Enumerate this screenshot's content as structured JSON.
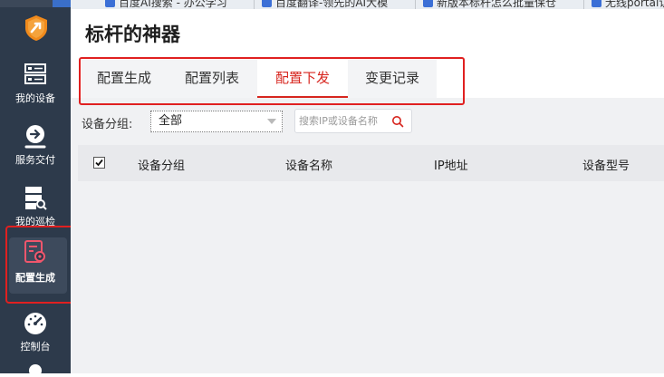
{
  "bookmarks": [
    {
      "label": "百度AI搜索 - 办公学习"
    },
    {
      "label": "百度翻译-领先的AI大模"
    },
    {
      "label": "新版本标杆怎么批量保仓"
    },
    {
      "label": "无线portal认"
    }
  ],
  "sidebar": {
    "items": [
      {
        "label": "我的设备",
        "icon": "server-icon"
      },
      {
        "label": "服务交付",
        "icon": "delivery-icon"
      },
      {
        "label": "我的巡检",
        "icon": "inspection-icon"
      },
      {
        "label": "配置生成",
        "icon": "config-gear-icon",
        "active": true
      },
      {
        "label": "控制台",
        "icon": "dashboard-gauge-icon"
      }
    ]
  },
  "header": {
    "title": "标杆的神器"
  },
  "tabs": [
    {
      "label": "配置生成"
    },
    {
      "label": "配置列表"
    },
    {
      "label": "配置下发",
      "active": true
    },
    {
      "label": "变更记录"
    }
  ],
  "filter": {
    "group_label": "设备分组:",
    "group_value": "全部",
    "search_placeholder": "搜索IP或设备名称"
  },
  "table": {
    "columns": [
      "设备分组",
      "设备名称",
      "IP地址",
      "设备型号"
    ],
    "header_checked": true
  },
  "colors": {
    "accent": "#d7261f",
    "sidebar_bg": "#2d3a4b",
    "highlight_box": "#e02020"
  }
}
